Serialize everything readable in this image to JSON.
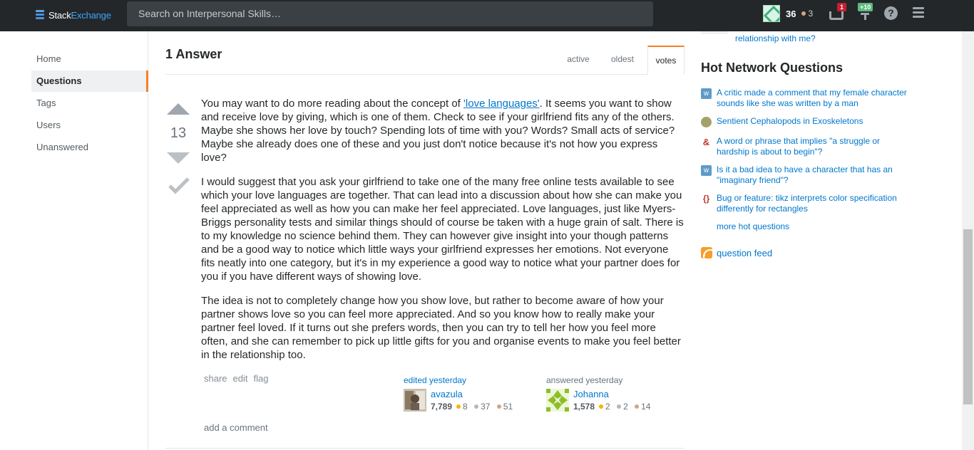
{
  "topbar": {
    "logo_stack": "Stack",
    "logo_exchange": "Exchange",
    "search_placeholder": "Search on Interpersonal Skills…",
    "my_rep": "36",
    "my_bronze": "3",
    "inbox_count": "1",
    "achievements_count": "+10",
    "help_glyph": "?"
  },
  "nav": {
    "items": [
      {
        "label": "Home"
      },
      {
        "label": "Questions"
      },
      {
        "label": "Tags"
      },
      {
        "label": "Users"
      },
      {
        "label": "Unanswered"
      }
    ]
  },
  "answers": {
    "count_label": "1 Answer",
    "sort_tabs": [
      {
        "label": "active"
      },
      {
        "label": "oldest"
      },
      {
        "label": "votes"
      }
    ],
    "vote_count": "13",
    "paragraphs": {
      "p1_before": "You may want to do more reading about the concept of ",
      "p1_link": "'love languages'",
      "p1_after": ". It seems you want to show and receive love by giving, which is one of them. Check to see if your girlfriend fits any of the others. Maybe she shows her love by touch? Spending lots of time with you? Words? Small acts of service? Maybe she already does one of these and you just don't notice because it's not how you express love?",
      "p2": "I would suggest that you ask your girlfriend to take one of the many free online tests available to see which your love languages are together. That can lead into a discussion about how she can make you feel appreciated as well as how you can make her feel appreciated. Love languages, just like Myers-Briggs personality tests and similar things should of course be taken with a huge grain of salt. There is to my knowledge no science behind them. They can however give insight into your though patterns and be a good way to notice which little ways your girlfriend expresses her emotions. Not everyone fits neatly into one category, but it's in my experience a good way to notice what your partner does for you if you have different ways of showing love.",
      "p3": "The idea is not to completely change how you show love, but rather to become aware of how your partner shows love so you can feel more appreciated. And so you know how to really make your partner feel loved. If it turns out she prefers words, then you can try to tell her how you feel more often, and she can remember to pick up little gifts for you and organise events to make you feel better in the relationship too."
    },
    "post_menu": {
      "share": "share",
      "edit": "edit",
      "flag": "flag"
    },
    "editor": {
      "action": "edited yesterday",
      "name": "avazula",
      "rep": "7,789",
      "gold": "8",
      "silver": "37",
      "bronze": "51"
    },
    "author": {
      "action": "answered yesterday",
      "name": "Johanna",
      "rep": "1,578",
      "gold": "2",
      "silver": "2",
      "bronze": "14"
    },
    "add_comment": "add a comment"
  },
  "sidebar": {
    "prev_link_text": "relationship with me?",
    "hnq_title": "Hot Network Questions",
    "hnq": [
      {
        "title": "A critic made a comment that my female character sounds like she was written by a man",
        "icon": "writing-site-icon"
      },
      {
        "title": "Sentient Cephalopods in Exoskeletons",
        "icon": "worldbuilding-site-icon"
      },
      {
        "title": "A word or phrase that implies \"a struggle or hardship is about to begin\"?",
        "icon": "english-site-icon"
      },
      {
        "title": "Is it a bad idea to have a character that has an \"imaginary friend\"?",
        "icon": "writing-site-icon"
      },
      {
        "title": "Bug or feature: tikz interprets color specification differently for rectangles",
        "icon": "tex-site-icon"
      }
    ],
    "more_hot": "more hot questions",
    "feed": "question feed"
  },
  "colors": {
    "topbar_bg": "#242729",
    "link": "#0077cc",
    "accent": "#f48024"
  }
}
